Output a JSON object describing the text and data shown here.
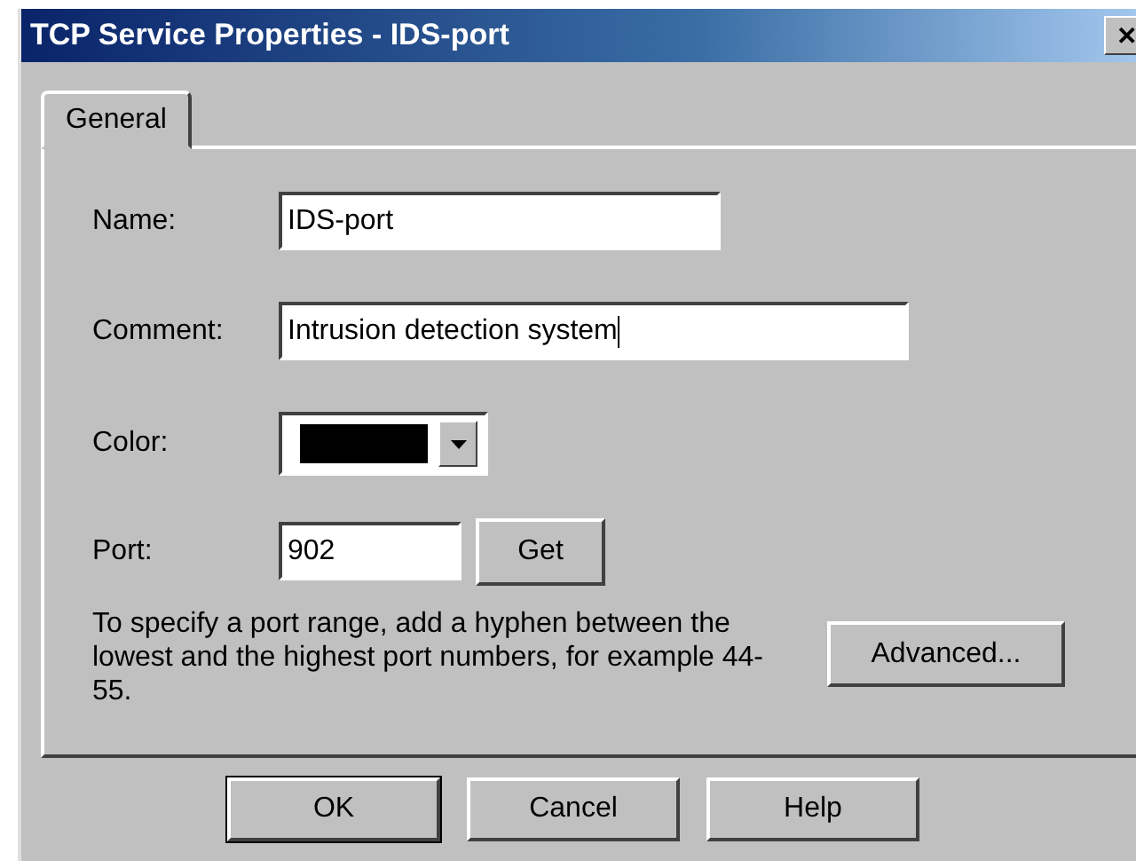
{
  "window": {
    "title": "TCP Service Properties - IDS-port",
    "close": "✕"
  },
  "tabs": [
    {
      "label": "General",
      "selected": true
    }
  ],
  "fields": [
    {
      "kind": "text",
      "label": "Name:",
      "value": "IDS-port"
    },
    {
      "kind": "text",
      "label": "Comment:",
      "value": "Intrusion detection system",
      "caret": true
    },
    {
      "kind": "color",
      "label": "Color:",
      "color": "#000000"
    },
    {
      "kind": "text",
      "label": "Port:",
      "value": "902",
      "button": "Get"
    }
  ],
  "note": "To specify a port range, add a hyphen between the lowest and the highest port numbers, for example 44-55.",
  "advanced_button": "Advanced...",
  "buttons": [
    {
      "label": "OK",
      "default": true
    },
    {
      "label": "Cancel",
      "default": false
    },
    {
      "label": "Help",
      "default": false
    }
  ]
}
